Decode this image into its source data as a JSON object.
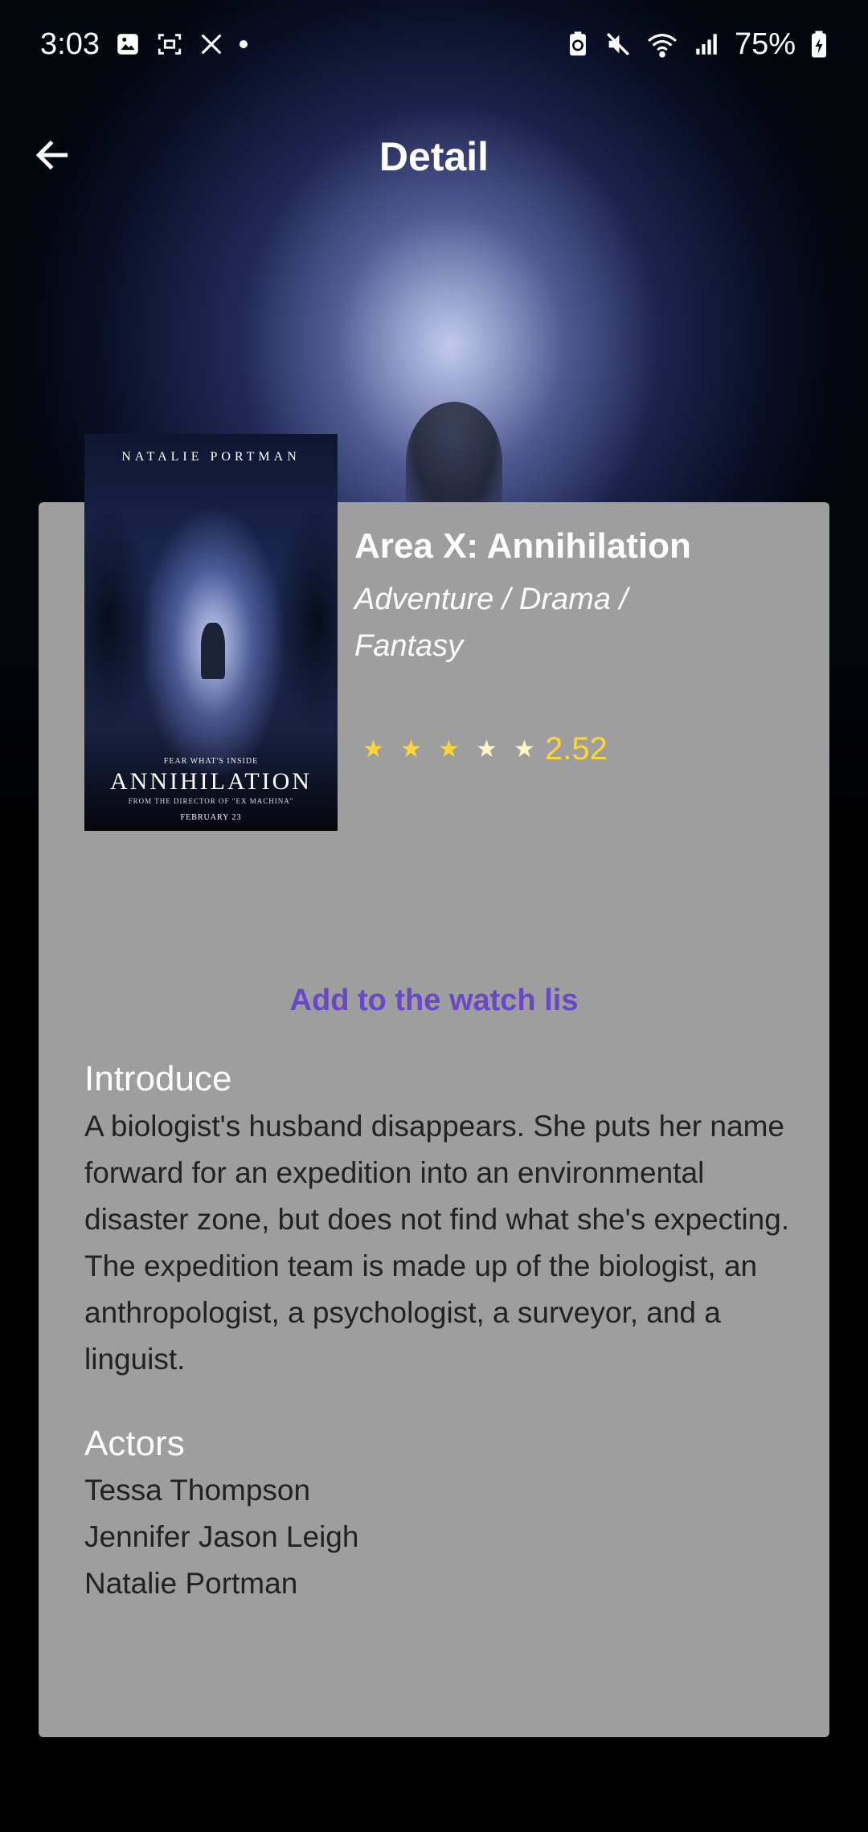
{
  "status_bar": {
    "time": "3:03",
    "battery_percent": "75%",
    "left_icons": [
      "gallery-icon",
      "screenshot-icon",
      "tools-icon",
      "dot-icon"
    ],
    "right_icons": [
      "battery-saver-icon",
      "mute-icon",
      "wifi-icon",
      "signal-icon",
      "battery-icon"
    ]
  },
  "app_bar": {
    "title": "Detail",
    "back_icon": "arrow-left-icon"
  },
  "poster": {
    "top_text": "NATALIE PORTMAN",
    "tagline": "FEAR WHAT'S INSIDE",
    "title": "ANNIHILATION",
    "subtitle": "FROM THE DIRECTOR OF \"EX MACHINA\"",
    "date": "FEBRUARY 23"
  },
  "movie": {
    "title": "Area X: Annihilation",
    "genres": "Adventure / Drama / Fantasy",
    "rating": "2.52",
    "stars_total": 5,
    "star_color": "#fdd835"
  },
  "actions": {
    "watch_list_label": "Add to the watch lis",
    "accent_color": "#6a47c4"
  },
  "introduce": {
    "heading": "Introduce",
    "text": "A biologist's husband disappears. She puts her name forward for an expedition into an environmental disaster zone, but does not find what she's expecting. The expedition team is made up of the biologist, an anthropologist, a psychologist, a surveyor, and a linguist."
  },
  "actors": {
    "heading": "Actors",
    "list": [
      "Tessa Thompson",
      "Jennifer Jason Leigh",
      "Natalie Portman"
    ]
  },
  "colors": {
    "card_background": "#9e9e9e",
    "page_background": "#000000"
  }
}
